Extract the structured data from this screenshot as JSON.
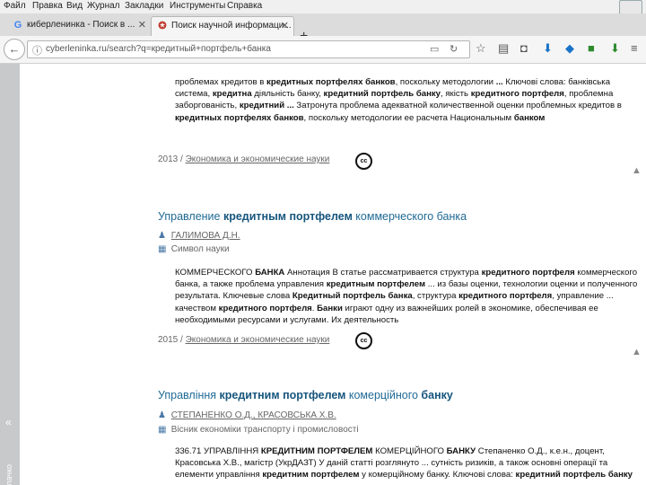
{
  "menu": [
    "Файл",
    "Правка",
    "Вид",
    "Журнал",
    "Закладки",
    "Инструменты",
    "Справка"
  ],
  "tabs": [
    {
      "label": "киберленинка - Поиск в ...",
      "active": false,
      "icon": "google-icon"
    },
    {
      "label": "Поиск научной информаци...",
      "active": true,
      "icon": "cyberleninka-icon"
    }
  ],
  "url": "cyberleninka.ru/search?q=кредитный+портфель+банка",
  "sidebar_label": "Облачко",
  "results": [
    {
      "abstract_html": "проблемах кредитов в <b>кредитных портфелях банков</b>, поскольку методологии <b>...</b> Ключові слова: банківська система, <b>кредитна</b> діяльність банку, <b>кредитний портфель банку</b>, якість <b>кредитного портфеля</b>, проблемна заборгованість, <b>кредитний ...</b> Затронута проблема адекватной количественной оценки проблемных кредитов в <b>кредитных портфелях банков</b>, поскольку методологии ее расчета Национальным <b>банком</b>",
      "year": "2013",
      "topic": "Экономика и экономические науки"
    },
    {
      "title_pre": "Управление ",
      "title_bold": "кредитным портфелем",
      "title_post": " коммерческого банка",
      "author": "ГАЛИМОВА Д.Н.",
      "journal": "Символ науки",
      "abstract_html": "КОММЕРЧЕСКОГО <b>БАНКА</b> Аннотация В статье рассматривается структура <b>кредитного портфеля</b> коммерческого банка, а также проблема управления <b>кредитным портфелем</b> ... из базы оценки, технологии оценки и полученного результата. Ключевые слова <b>Кредитный портфель банка</b>, структура <b>кредитного портфеля</b>, управление ... качеством <b>кредитного портфеля</b>. <b>Банки</b> играют одну из важнейших ролей в экономике, обеспечивая ее необходимыми ресурсами и услугами. Их деятельность",
      "year": "2015",
      "topic": "Экономика и экономические науки"
    },
    {
      "title_pre": "Управління ",
      "title_bold": "кредитним портфелем",
      "title_post": " комерційного ",
      "title_bold2": "банку",
      "author": "СТЕПАНЕНКО О.Д., КРАСОВСЬКА Х.В.",
      "journal": "Вісник економіки транспорту і промисловості",
      "abstract_html": "336.71 УПРАВЛІННЯ <b>КРЕДИТНИМ ПОРТФЕЛЕМ</b> КОМЕРЦІЙНОГО <b>БАНКУ</b> Степаненко О.Д., к.е.н., доцент, Красовська Х.В., магістр (УкрДАЗТ) У даній статті розглянуто ... сутність ризиків, а також основні операції та елементи управління <b>кредитним портфелем</b> у комерційному банку. Ключові слова: <b>кредитний портфель банку</b>"
    }
  ],
  "cc_label": "cc"
}
